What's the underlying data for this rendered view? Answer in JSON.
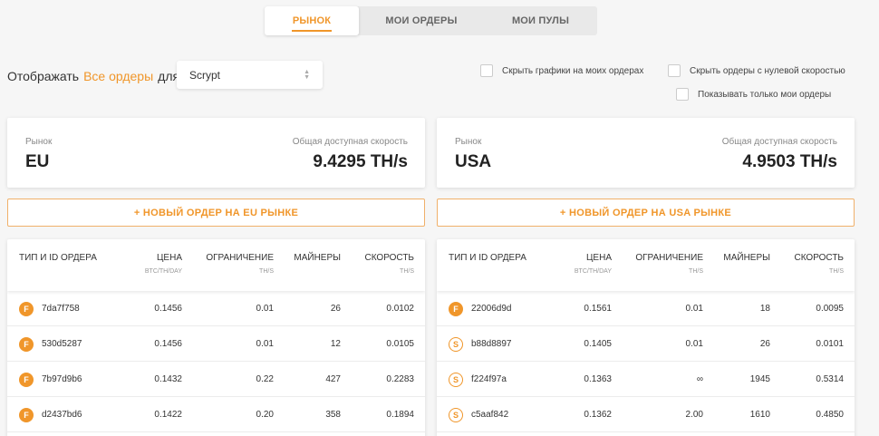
{
  "tabs": [
    {
      "label": "РЫНОК",
      "active": true
    },
    {
      "label": "МОИ ОРДЕРЫ",
      "active": false
    },
    {
      "label": "МОИ ПУЛЫ",
      "active": false
    }
  ],
  "filter": {
    "prefix": "Отображать",
    "orders_link": "Все ордеры",
    "suffix": "для",
    "algorithm": "Scrypt"
  },
  "checkboxes": {
    "hide_charts": "Скрыть графики на моих ордерах",
    "hide_zero": "Скрыть ордеры с нулевой скоростью",
    "only_mine": "Показывать только мои ордеры"
  },
  "accent_color": "#f0962a",
  "markets": [
    {
      "market_label": "Рынок",
      "market_name": "EU",
      "speed_label": "Общая доступная скорость",
      "speed_value": "9.4295 TH/s",
      "new_order": "+ НОВЫЙ ОРДЕР НА EU РЫНКЕ",
      "headers": {
        "type": "ТИП И ID ОРДЕРА",
        "price": "ЦЕНА",
        "price_unit": "BTC/TH/DAY",
        "limit": "ОГРАНИЧЕНИЕ",
        "limit_unit": "TH/S",
        "miners": "МАЙНЕРЫ",
        "speed": "СКОРОСТЬ",
        "speed_unit": "TH/S"
      },
      "rows": [
        {
          "type": "F",
          "id": "7da7f758",
          "price": "0.1456",
          "limit": "0.01",
          "miners": "26",
          "speed": "0.0102"
        },
        {
          "type": "F",
          "id": "530d5287",
          "price": "0.1456",
          "limit": "0.01",
          "miners": "12",
          "speed": "0.0105"
        },
        {
          "type": "F",
          "id": "7b97d9b6",
          "price": "0.1432",
          "limit": "0.22",
          "miners": "427",
          "speed": "0.2283"
        },
        {
          "type": "F",
          "id": "d2437bd6",
          "price": "0.1422",
          "limit": "0.20",
          "miners": "358",
          "speed": "0.1894"
        }
      ]
    },
    {
      "market_label": "Рынок",
      "market_name": "USA",
      "speed_label": "Общая доступная скорость",
      "speed_value": "4.9503 TH/s",
      "new_order": "+ НОВЫЙ ОРДЕР НА USA РЫНКЕ",
      "headers": {
        "type": "ТИП И ID ОРДЕРА",
        "price": "ЦЕНА",
        "price_unit": "BTC/TH/DAY",
        "limit": "ОГРАНИЧЕНИЕ",
        "limit_unit": "TH/S",
        "miners": "МАЙНЕРЫ",
        "speed": "СКОРОСТЬ",
        "speed_unit": "TH/S"
      },
      "rows": [
        {
          "type": "F",
          "id": "22006d9d",
          "price": "0.1561",
          "limit": "0.01",
          "miners": "18",
          "speed": "0.0095"
        },
        {
          "type": "S",
          "id": "b88d8897",
          "price": "0.1405",
          "limit": "0.01",
          "miners": "26",
          "speed": "0.0101"
        },
        {
          "type": "S",
          "id": "f224f97a",
          "price": "0.1363",
          "limit": "∞",
          "miners": "1945",
          "speed": "0.5314"
        },
        {
          "type": "S",
          "id": "c5aaf842",
          "price": "0.1362",
          "limit": "2.00",
          "miners": "1610",
          "speed": "0.4850"
        }
      ]
    }
  ]
}
